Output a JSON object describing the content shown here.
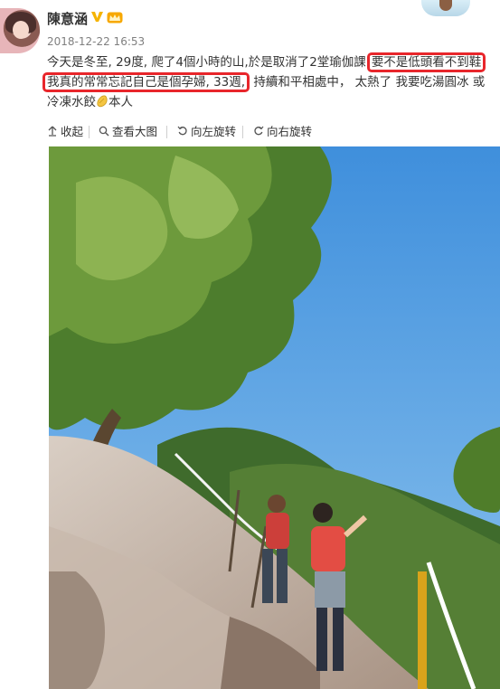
{
  "user": {
    "name": "陳意涵",
    "timestamp": "2018-12-22 16:53"
  },
  "post": {
    "line1_a": "今天是冬至, 29度, 爬了4個小時的山,於是取消了2堂瑜伽課",
    "line1_highlight": "要不是低頭看不到鞋",
    "line2_highlight": "我真的常常忘記自己是個孕婦, 33週,",
    "line2_b": "持續和平相處中， 太熱了 我要吃湯圓冰 或",
    "line3_a": "冷凍水餃",
    "line3_b": "本人"
  },
  "actions": {
    "collapse": "收起",
    "view_large": "查看大图",
    "rotate_left": "向左旋转",
    "rotate_right": "向右旋转"
  },
  "colors": {
    "highlight_border": "#e8262b",
    "verify_badge": "#f5b400",
    "sky": "#5aa3e0"
  },
  "icons": {
    "verify": "verified-v-icon",
    "vip": "crown-icon",
    "emoji": "dumpling-emoji-icon",
    "collapse": "arrow-up-icon",
    "view_large": "magnifier-icon",
    "rotate_left": "rotate-left-icon",
    "rotate_right": "rotate-right-icon"
  }
}
